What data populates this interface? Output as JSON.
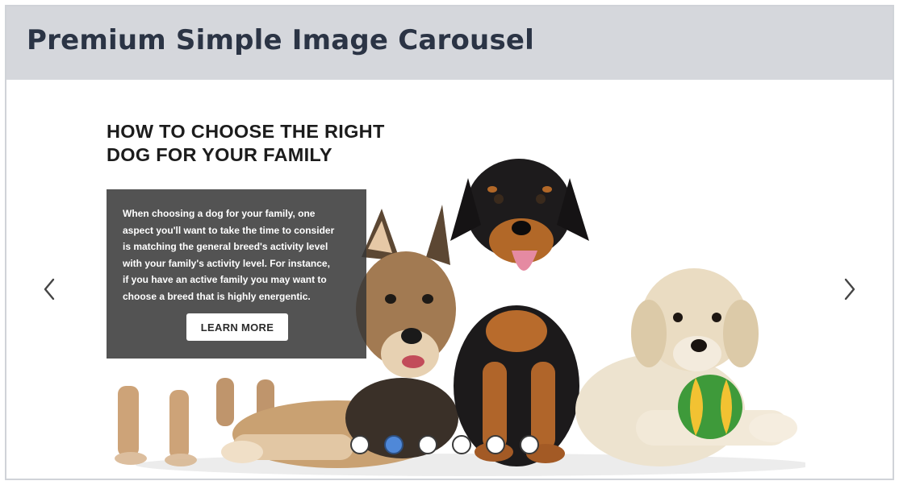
{
  "header": {
    "title": "Premium Simple Image Carousel"
  },
  "carousel": {
    "slide": {
      "heading_line1": "HOW TO CHOOSE THE RIGHT",
      "heading_line2": "DOG FOR YOUR FAMILY",
      "body": [
        "When choosing a dog for your family, one",
        "aspect you'll want to take the time to consider",
        "is matching the general breed's activity level",
        "with your family's activity level. For instance,",
        "if you have an active family you may want to",
        "choose a breed that is highly energentic."
      ],
      "button_label": "LEARN MORE",
      "image_subject": "three dogs: german shepherd puppy, rottweiler puppy, golden retriever puppy with ball"
    },
    "prev_icon": "chevron-left-icon",
    "next_icon": "chevron-right-icon",
    "dot_count": 6,
    "active_dot": 1,
    "colors": {
      "header_bg": "#d5d7dc",
      "title": "#2b3445",
      "active_dot": "#4f88d8",
      "text_box_bg": "#373737"
    }
  }
}
